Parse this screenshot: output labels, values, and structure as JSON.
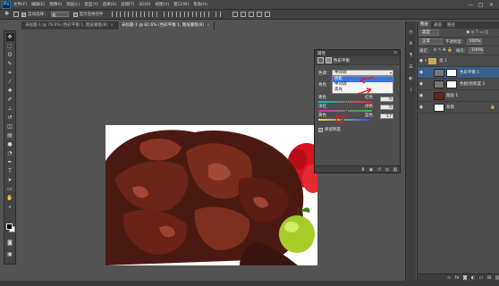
{
  "app": {
    "logo": "Ps",
    "menu": [
      "文件(F)",
      "编辑(E)",
      "图像(I)",
      "图层(L)",
      "类型(Y)",
      "选择(S)",
      "滤镜(T)",
      "3D(D)",
      "视图(V)",
      "窗口(W)",
      "帮助(H)"
    ],
    "window_controls": [
      "—",
      "□",
      "×"
    ]
  },
  "options": {
    "auto_select_label": "自动选择：",
    "auto_select_value": "组",
    "show_transform_label": "显示变换控件"
  },
  "tabs": [
    {
      "label": "未标题-1 @ 79.6% (色彩平衡 1, 图层蒙版/8)",
      "active": false
    },
    {
      "label": "未标题-1 @ 82.6% (色彩平衡 1, 图层蒙版/8)",
      "active": true
    }
  ],
  "properties": {
    "panel_title": "属性",
    "adjustment_title": "色彩平衡",
    "tone_label": "色调：",
    "tone_value": "中间调",
    "tone_options": [
      "阴影",
      "中间调",
      "高光"
    ],
    "tone_selected_index": 0,
    "cyan_label": "青色",
    "red_label": "红色",
    "cyan_red_value": "0",
    "magenta_label": "洋红",
    "green_label": "绿色",
    "magenta_green_value": "0",
    "yellow_label": "黄色",
    "blue_label": "蓝色",
    "yellow_blue_value": "-17",
    "preserve_label": "保留明度"
  },
  "layers": {
    "tabs": [
      "图层",
      "通道",
      "路径"
    ],
    "filter_label": "类型",
    "blend_mode": "正常",
    "opacity_label": "不透明度：",
    "opacity_value": "100%",
    "lock_label": "锁定：",
    "fill_label": "填充：",
    "fill_value": "100%",
    "items": [
      {
        "name": "组 1",
        "type": "group",
        "active": false
      },
      {
        "name": "色彩平衡 1",
        "type": "adjustment",
        "active": true
      },
      {
        "name": "色相/饱和度 1",
        "type": "adjustment",
        "active": false
      },
      {
        "name": "图层 1",
        "type": "pixel",
        "active": false
      },
      {
        "name": "背景",
        "type": "background",
        "active": false
      }
    ]
  },
  "colors": {
    "accent": "#3875d7",
    "highlight": "#e02020",
    "layer_active": "#39608a"
  }
}
